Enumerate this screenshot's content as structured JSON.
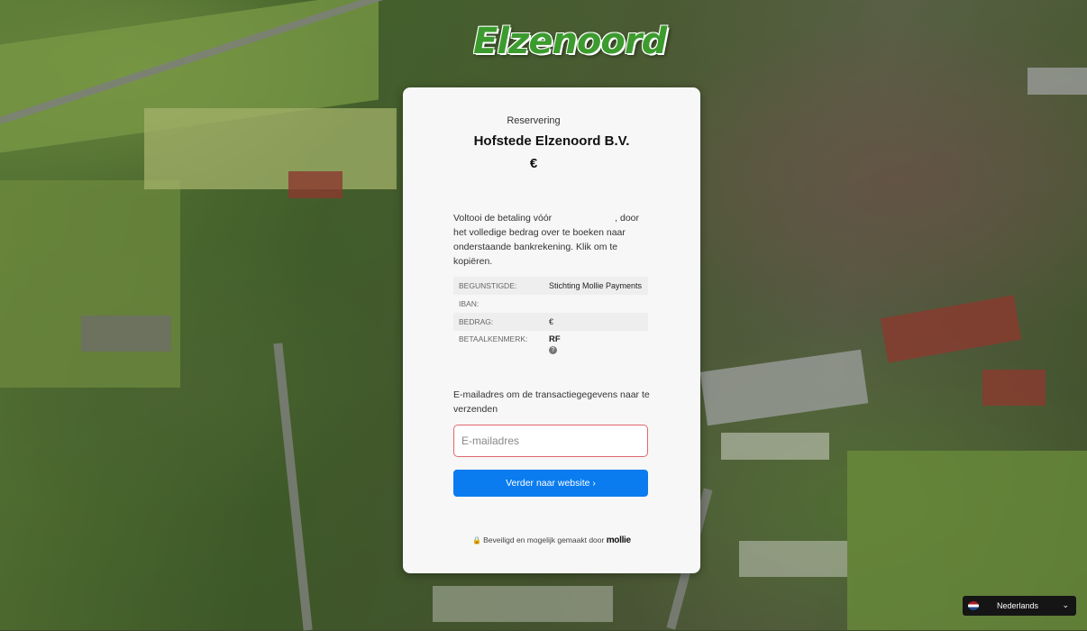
{
  "logo": {
    "text": "Elzenoord"
  },
  "payment": {
    "eyebrow": "Reservering",
    "merchant": "Hofstede Elzenoord B.V.",
    "amount": "€",
    "instructions_part1": "Voltooi de betaling vóór",
    "instructions_part2": ", door het volledige bedrag over te boeken naar onderstaande bankrekening. Klik om te kopiëren.",
    "details": [
      {
        "key": "BEGUNSTIGDE:",
        "value": "Stichting Mollie Payments"
      },
      {
        "key": "IBAN:",
        "value": ""
      },
      {
        "key": "BEDRAG:",
        "value": "€"
      },
      {
        "key": "BETAALKENMERK:",
        "value": "RF"
      }
    ],
    "email_label": "E-mailadres om de transactiegegevens naar te verzenden",
    "email_placeholder": "E-mailadres",
    "email_value": "",
    "cta_label": "Verder naar website ›",
    "footer_text": "Beveiligd en mogelijk gemaakt door",
    "footer_brand": "mollie"
  },
  "language": {
    "selected": "Nederlands"
  },
  "colors": {
    "primary": "#0a7cf0",
    "error_border": "#e0676f",
    "logo_green": "#3c9b2e"
  }
}
